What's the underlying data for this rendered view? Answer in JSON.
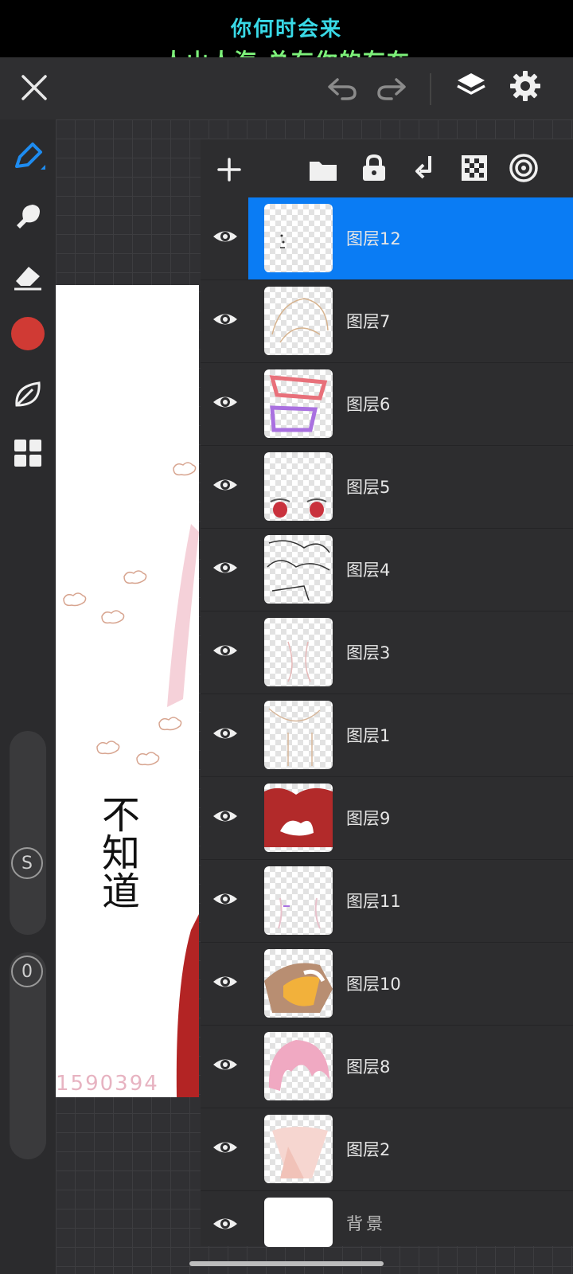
{
  "caption": {
    "line1": "你何时会来",
    "line2": "人山人海 总有你的存在"
  },
  "topbar": {
    "close_icon": "close-icon",
    "undo_icon": "undo-icon",
    "redo_icon": "redo-icon",
    "layers_icon": "layers-icon",
    "settings_icon": "gear-icon"
  },
  "left_tools": {
    "brush": "brush-icon",
    "smudge": "smudge-icon",
    "eraser": "eraser-icon",
    "color": "#d03a34",
    "leaf": "leaf-icon",
    "grid": "grid-icon",
    "size_label": "S",
    "opacity_label": "0"
  },
  "canvas": {
    "text_vertical": "不知道",
    "watermark": "1590394"
  },
  "layer_toolbar": {
    "add": "add-icon",
    "folder": "folder-icon",
    "lock": "lock-icon",
    "merge": "merge-down-icon",
    "alpha": "checker-icon",
    "blend": "target-icon"
  },
  "layers": [
    {
      "name": "图层12",
      "selected": true
    },
    {
      "name": "图层7",
      "selected": false
    },
    {
      "name": "图层6",
      "selected": false
    },
    {
      "name": "图层5",
      "selected": false
    },
    {
      "name": "图层4",
      "selected": false
    },
    {
      "name": "图层3",
      "selected": false
    },
    {
      "name": "图层1",
      "selected": false
    },
    {
      "name": "图层9",
      "selected": false
    },
    {
      "name": "图层11",
      "selected": false
    },
    {
      "name": "图层10",
      "selected": false
    },
    {
      "name": "图层8",
      "selected": false
    },
    {
      "name": "图层2",
      "selected": false
    }
  ],
  "background_layer": {
    "name": "背景"
  },
  "colors": {
    "accent": "#0a7cf4",
    "panel": "#2d2d2f"
  }
}
